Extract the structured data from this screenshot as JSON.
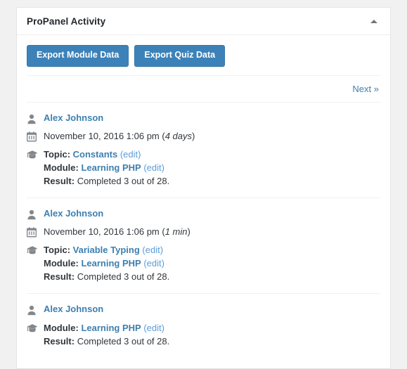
{
  "panel": {
    "title": "ProPanel Activity",
    "toggle_icon": "triangle-up-icon"
  },
  "toolbar": {
    "export_module_label": "Export Module Data",
    "export_quiz_label": "Export Quiz Data"
  },
  "pagination": {
    "next_label": "Next »"
  },
  "labels": {
    "topic": "Topic:",
    "module": "Module:",
    "result": "Result:",
    "edit": "(edit)"
  },
  "colors": {
    "button_blue": "#3c82b8",
    "link_blue": "#3c7fb1",
    "edit_blue": "#5b9dd9",
    "text_dark": "#32373c",
    "page_bg": "#f1f1f1",
    "panel_bg": "#ffffff",
    "border": "#e5e5e5"
  },
  "icons": {
    "user": "user-icon",
    "calendar": "calendar-icon",
    "graduation": "graduation-cap-icon"
  },
  "entries": [
    {
      "user": "Alex Johnson",
      "date": "November 10, 2016 1:06 pm",
      "relative": "4 days",
      "has_date": true,
      "has_topic": true,
      "topic": "Constants",
      "module": "Learning PHP",
      "result": "Completed 3 out of 28."
    },
    {
      "user": "Alex Johnson",
      "date": "November 10, 2016 1:06 pm",
      "relative": "1 min",
      "has_date": true,
      "has_topic": true,
      "topic": "Variable Typing",
      "module": "Learning PHP",
      "result": "Completed 3 out of 28."
    },
    {
      "user": "Alex Johnson",
      "date": "",
      "relative": "",
      "has_date": false,
      "has_topic": false,
      "topic": "",
      "module": "Learning PHP",
      "result": "Completed 3 out of 28."
    }
  ]
}
